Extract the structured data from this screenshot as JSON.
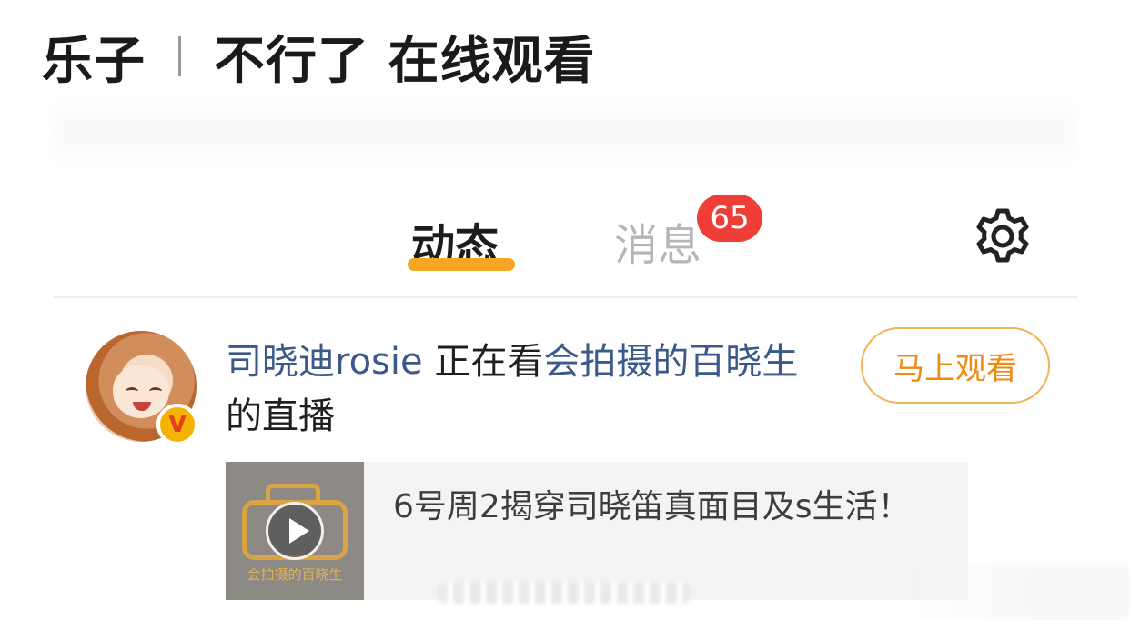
{
  "post": {
    "left": "乐子",
    "right": "不行了 在线观看"
  },
  "tabs": {
    "active": "动态",
    "inactive": "消息",
    "badge": "65"
  },
  "icons": {
    "settings": "gear-icon",
    "verified": "verified-v-icon",
    "play": "play-icon"
  },
  "feed": {
    "user_name": "司晓迪rosie",
    "action": " 正在看",
    "target_user": "会拍摄的百晓生",
    "suffix": " 的直播",
    "watch_button": "马上观看",
    "verified_label": "V"
  },
  "live_card": {
    "title": "6号周2揭穿司晓笛真面目及s生活！",
    "thumb_caption": "会拍摄的百晓生"
  },
  "colors": {
    "accent": "#f6a623",
    "badge": "#ef3e36",
    "link": "#3b5a8a",
    "button_text": "#ef8b12"
  }
}
